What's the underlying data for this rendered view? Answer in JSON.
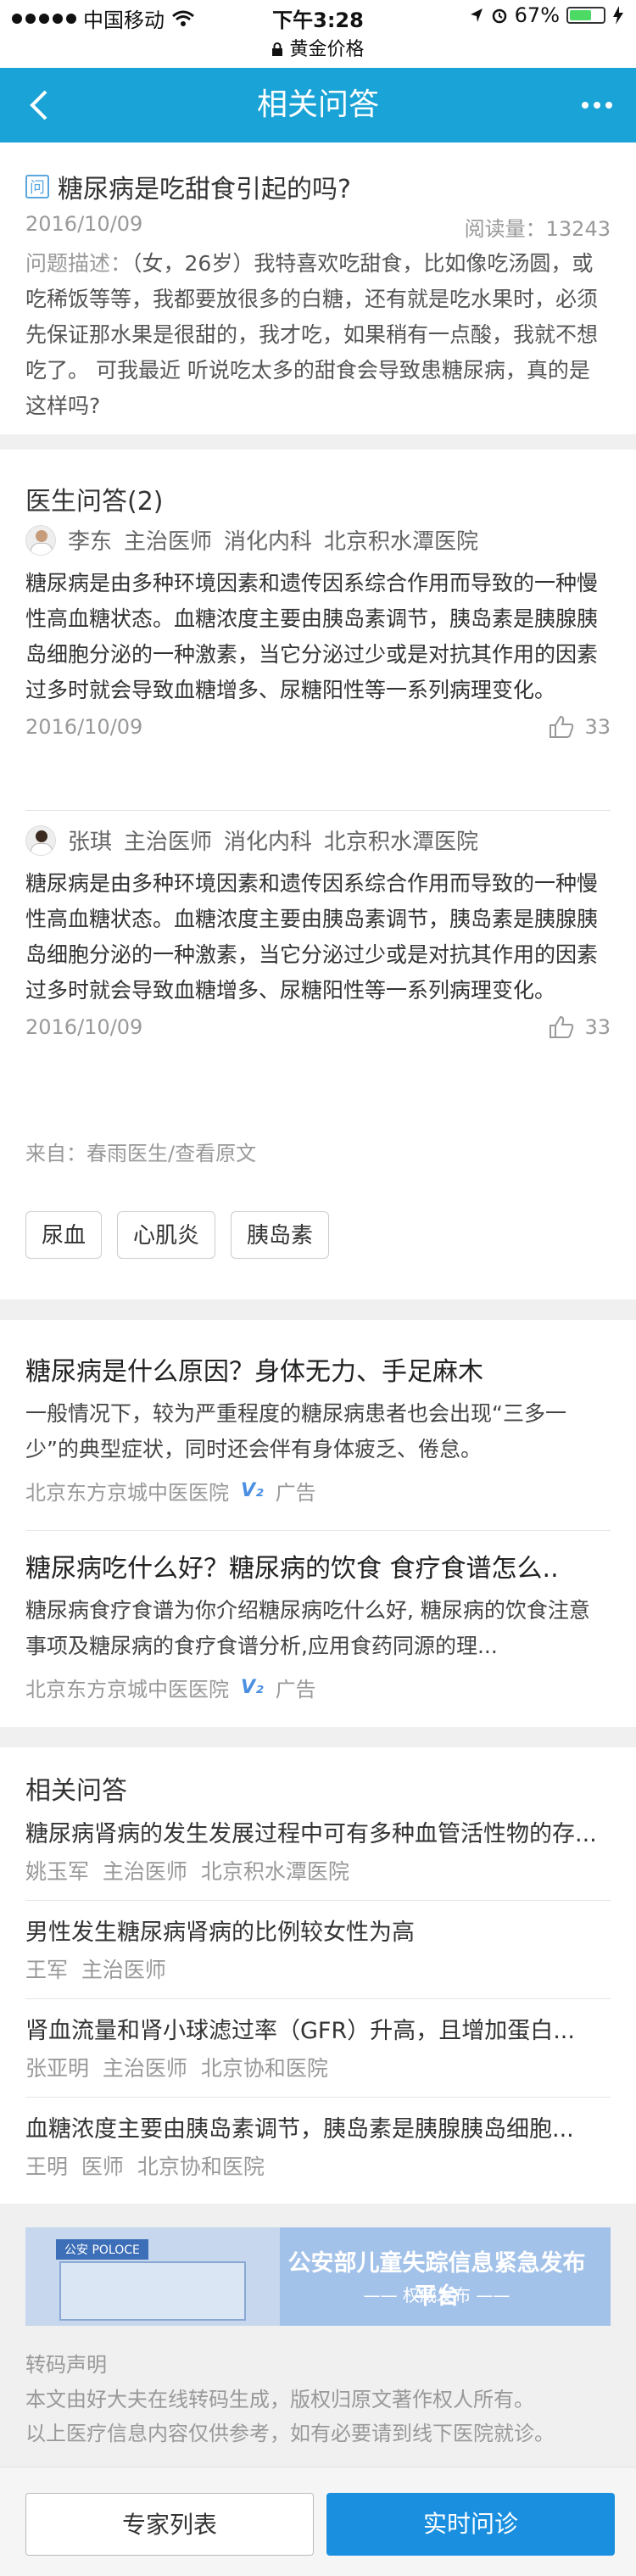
{
  "status_bar": {
    "carrier": "中国移动",
    "time": "下午3:28",
    "battery": "67%",
    "battery_level": 0.67,
    "site": "黄金价格"
  },
  "nav": {
    "title": "相关问答",
    "back_icon": "chevron-left-icon",
    "more_icon": "more-dots-icon"
  },
  "question": {
    "badge": "问",
    "title": "糖尿病是吃甜食引起的吗?",
    "date": "2016/10/09",
    "read_count": "阅读量：13243",
    "desc_label": "问题描述：",
    "desc": "（女，26岁）我特喜欢吃甜食，比如像吃汤圆，或吃稀饭等等，我都要放很多的白糖，还有就是吃水果时，必须先保证那水果是很甜的，我才吃，如果稍有一点酸，我就不想吃了。 可我最近 听说吃太多的甜食会导致患糖尿病，真的是这样吗?"
  },
  "doctor_answers": {
    "header": "医生问答(2)",
    "items": [
      {
        "name": "李东",
        "title": "主治医师",
        "dept": "消化内科",
        "hospital": "北京积水潭医院",
        "text": "糖尿病是由多种环境因素和遗传因系综合作用而导致的一种慢性高血糖状态。血糖浓度主要由胰岛素调节，胰岛素是胰腺胰岛细胞分泌的一种激素，当它分泌过少或是对抗其作用的因素过多时就会导致血糖增多、尿糖阳性等一系列病理变化。",
        "date": "2016/10/09",
        "likes": "33"
      },
      {
        "name": "张琪",
        "title": "主治医师",
        "dept": "消化内科",
        "hospital": "北京积水潭医院",
        "text": "糖尿病是由多种环境因素和遗传因系综合作用而导致的一种慢性高血糖状态。血糖浓度主要由胰岛素调节，胰岛素是胰腺胰岛细胞分泌的一种激素，当它分泌过少或是对抗其作用的因素过多时就会导致血糖增多、尿糖阳性等一系列病理变化。",
        "date": "2016/10/09",
        "likes": "33"
      }
    ],
    "source": "来自：春雨医生/查看原文",
    "tags": [
      "尿血",
      "心肌炎",
      "胰岛素"
    ]
  },
  "ads": [
    {
      "title": "糖尿病是什么原因？身体无力、手足麻木",
      "desc": "一般情况下，较为严重程度的糖尿病患者也会出现“三多一少”的典型症状，同时还会伴有身体疲乏、倦怠。",
      "advertiser": "北京东方京城中医医院",
      "v_badge": "V₂",
      "ad_label": "广告"
    },
    {
      "title": "糖尿病吃什么好？糖尿病的饮食 食疗食谱怎么..",
      "desc": "糖尿病食疗食谱为你介绍糖尿病吃什么好, 糖尿病的饮食注意事项及糖尿病的食疗食谱分析,应用食药同源的理...",
      "advertiser": "北京东方京城中医医院",
      "v_badge": "V₂",
      "ad_label": "广告"
    }
  ],
  "related": {
    "header": "相关问答",
    "items": [
      {
        "question": "糖尿病肾病的发生发展过程中可有多种血管活性物的存...",
        "doctor": "姚玉军",
        "title": "主治医师",
        "hospital": "北京积水潭医院"
      },
      {
        "question": "男性发生糖尿病肾病的比例较女性为高",
        "doctor": "王军",
        "title": "主治医师",
        "hospital": ""
      },
      {
        "question": "肾血流量和肾小球滤过率（GFR）升高，且增加蛋白...",
        "doctor": "张亚明",
        "title": "主治医师",
        "hospital": "北京协和医院"
      },
      {
        "question": "血糖浓度主要由胰岛素调节，胰岛素是胰腺胰岛细胞...",
        "doctor": "王明",
        "title": "医师",
        "hospital": "北京协和医院"
      }
    ]
  },
  "banner": {
    "police_label": "公安 POLOCE",
    "title": "公安部儿童失踪信息紧急发布平台",
    "subtitle": "—— 权威发布 ——"
  },
  "notice": {
    "title": "转码声明",
    "line1": "本文由好大夫在线转码生成，版权归原文著作权人所有。",
    "line2": "以上医疗信息内容仅供参考，如有必要请到线下医院就诊。"
  },
  "buttons": {
    "expert_list": "专家列表",
    "ask_now": "实时问诊"
  },
  "colors": {
    "nav_bg": "#1aa3d6",
    "primary_button": "#1a8fe0",
    "ad_badge": "#4a8fe2"
  }
}
